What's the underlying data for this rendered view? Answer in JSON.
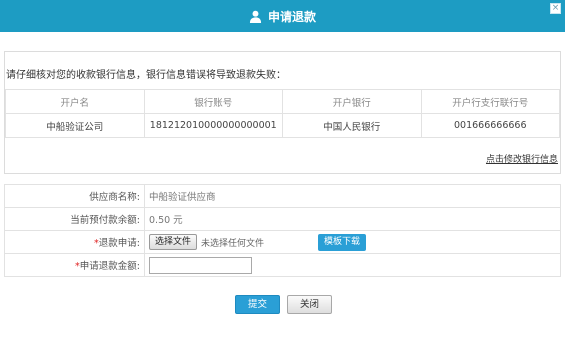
{
  "dialog": {
    "title": "申请退款",
    "close_glyph": "×"
  },
  "bank": {
    "notice": "请仔细核对您的收款银行信息，银行信息错误将导致退款失败：",
    "columns": [
      "开户名",
      "银行账号",
      "开户银行",
      "开户行支行联行号"
    ],
    "rows": [
      [
        "中船验证公司",
        "181212010000000000001",
        "中国人民银行",
        "001666666666"
      ]
    ],
    "modify_link": "点击修改银行信息"
  },
  "form": {
    "supplier_label": "供应商名称:",
    "supplier_value": "中船验证供应商",
    "balance_label": "当前预付款余额:",
    "balance_value": "0.50 元",
    "apply_label": "退款申请:",
    "file_button": "选择文件",
    "file_status": "未选择任何文件",
    "template_button": "模板下载",
    "amount_label": "申请退款金额:",
    "amount_value": "",
    "required_mark": "*"
  },
  "buttons": {
    "submit": "提交",
    "close": "关闭"
  },
  "colors": {
    "title_bar": "#1d9cc3",
    "primary_button": "#2a9fd6",
    "required": "#e02020"
  },
  "icons": {
    "title": "user-icon",
    "close": "close-icon"
  }
}
